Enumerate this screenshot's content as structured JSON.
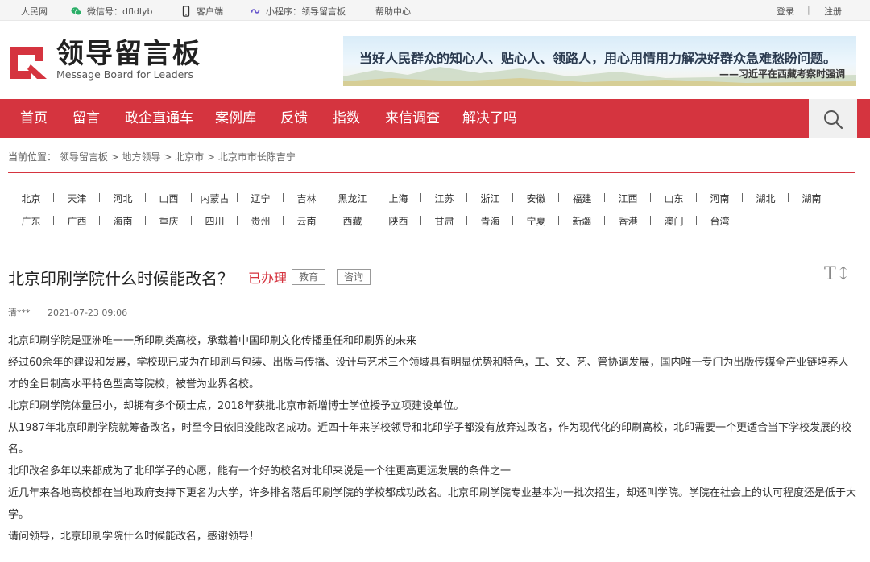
{
  "topbar": {
    "people_net": "人民网",
    "wechat": "微信号：dfldlyb",
    "client": "客户端",
    "miniprogram": "小程序：领导留言板",
    "help": "帮助中心",
    "login": "登录",
    "divider": "|",
    "register": "注册"
  },
  "header": {
    "brand_cn": "领导留言板",
    "brand_en": "Message Board for Leaders",
    "banner_quote": "当好人民群众的知心人、贴心人、领路人，用心用情用力解决好群众急难愁盼问题。",
    "banner_author": "——习近平在西藏考察时强调"
  },
  "nav": [
    "首页",
    "留言",
    "政企直通车",
    "案例库",
    "反馈",
    "指数",
    "来信调查",
    "解决了吗"
  ],
  "breadcrumb": "当前位置： 领导留言板 > 地方领导 > 北京市 > 北京市市长陈吉宁",
  "regions": {
    "row1": [
      "北京",
      "天津",
      "河北",
      "山西",
      "内蒙古",
      "辽宁",
      "吉林",
      "黑龙江",
      "上海",
      "江苏",
      "浙江",
      "安徽",
      "福建",
      "江西",
      "山东",
      "河南",
      "湖北",
      "湖南"
    ],
    "row2": [
      "广东",
      "广西",
      "海南",
      "重庆",
      "四川",
      "贵州",
      "云南",
      "西藏",
      "陕西",
      "甘肃",
      "青海",
      "宁夏",
      "新疆",
      "香港",
      "澳门",
      "台湾"
    ]
  },
  "message": {
    "title": "北京印刷学院什么时候能改名？",
    "status": "已办理",
    "tags": [
      "教育",
      "咨询"
    ],
    "font_toggle": "T↕",
    "author": "清***",
    "date": "2021-07-23 09:06",
    "paragraphs": [
      "北京印刷学院是亚洲唯一一所印刷类高校，承载着中国印刷文化传播重任和印刷界的未来",
      "经过60余年的建设和发展，学校现已成为在印刷与包装、出版与传播、设计与艺术三个领域具有明显优势和特色，工、文、艺、管协调发展，国内唯一专门为出版传媒全产业链培养人才的全日制高水平特色型高等院校，被誉为业界名校。",
      "北京印刷学院体量虽小，却拥有多个硕士点，2018年获批北京市新增博士学位授予立项建设单位。",
      "从1987年北京印刷学院就筹备改名，时至今日依旧没能改名成功。近四十年来学校领导和北印学子都没有放弃过改名，作为现代化的印刷高校，北印需要一个更适合当下学校发展的校名。",
      "北印改名多年以来都成为了北印学子的心愿，能有一个好的校名对北印来说是一个往更高更远发展的条件之一",
      "近几年来各地高校都在当地政府支持下更名为大学，许多排名落后印刷学院的学校都成功改名。北京印刷学院专业基本为一批次招生，却还叫学院。学院在社会上的认可程度还是低于大学。",
      "请问领导，北京印刷学院什么时候能改名，感谢领导！"
    ]
  },
  "colors": {
    "brand_red": "#d5343f",
    "nav_text": "#ffffff"
  }
}
